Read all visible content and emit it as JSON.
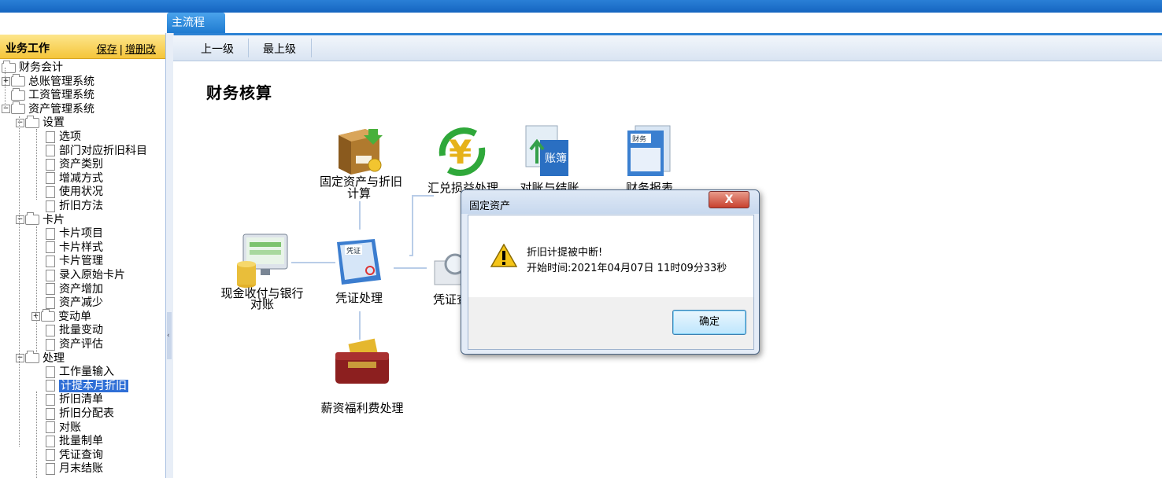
{
  "tabs": {
    "main": "主流程"
  },
  "sidebar": {
    "title": "业务工作",
    "save_link": "保存",
    "separator": "|",
    "edit_link": "增删改",
    "tree": [
      {
        "label": "财务会计",
        "level": 0,
        "kind": "folder"
      },
      {
        "label": "总账管理系统",
        "level": 1,
        "kind": "folder"
      },
      {
        "label": "工资管理系统",
        "level": 1,
        "kind": "folder"
      },
      {
        "label": "资产管理系统",
        "level": 1,
        "kind": "folder"
      },
      {
        "label": "设置",
        "level": 2,
        "kind": "folder"
      },
      {
        "label": "选项",
        "level": 3,
        "kind": "doc"
      },
      {
        "label": "部门对应折旧科目",
        "level": 3,
        "kind": "doc"
      },
      {
        "label": "资产类别",
        "level": 3,
        "kind": "doc"
      },
      {
        "label": "增减方式",
        "level": 3,
        "kind": "doc"
      },
      {
        "label": "使用状况",
        "level": 3,
        "kind": "doc"
      },
      {
        "label": "折旧方法",
        "level": 3,
        "kind": "doc"
      },
      {
        "label": "卡片",
        "level": 2,
        "kind": "folder"
      },
      {
        "label": "卡片项目",
        "level": 3,
        "kind": "doc"
      },
      {
        "label": "卡片样式",
        "level": 3,
        "kind": "doc"
      },
      {
        "label": "卡片管理",
        "level": 3,
        "kind": "doc"
      },
      {
        "label": "录入原始卡片",
        "level": 3,
        "kind": "doc"
      },
      {
        "label": "资产增加",
        "level": 3,
        "kind": "doc"
      },
      {
        "label": "资产减少",
        "level": 3,
        "kind": "doc"
      },
      {
        "label": "变动单",
        "level": 3,
        "kind": "folder"
      },
      {
        "label": "批量变动",
        "level": 3,
        "kind": "doc"
      },
      {
        "label": "资产评估",
        "level": 3,
        "kind": "doc"
      },
      {
        "label": "处理",
        "level": 2,
        "kind": "folder"
      },
      {
        "label": "工作量输入",
        "level": 3,
        "kind": "doc"
      },
      {
        "label": "计提本月折旧",
        "level": 3,
        "kind": "doc",
        "selected": true
      },
      {
        "label": "折旧清单",
        "level": 3,
        "kind": "doc"
      },
      {
        "label": "折旧分配表",
        "level": 3,
        "kind": "doc"
      },
      {
        "label": "对账",
        "level": 3,
        "kind": "doc"
      },
      {
        "label": "批量制单",
        "level": 3,
        "kind": "doc"
      },
      {
        "label": "凭证查询",
        "level": 3,
        "kind": "doc"
      },
      {
        "label": "月末结账",
        "level": 3,
        "kind": "doc"
      }
    ]
  },
  "toolbar": {
    "up_one": "上一级",
    "top_level": "最上级"
  },
  "main": {
    "heading": "财务核算",
    "nodes": {
      "fixed_assets": "固定资产与折旧计算",
      "fixed_assets_l1": "固定资产与折旧",
      "fixed_assets_l2": "计算",
      "fx": "汇兑损益处理",
      "reconcile": "对账与结账",
      "reports": "财务报表",
      "cash": "现金收付与银行对账",
      "cash_l1": "现金收付与银行",
      "cash_l2": "对账",
      "voucher": "凭证处理",
      "voucher_query": "凭证查询",
      "payroll": "薪资福利费处理"
    },
    "icon_texts": {
      "voucher_icon": "凭证",
      "ledger_icon": "账簿",
      "report_icon": "财务"
    }
  },
  "dialog": {
    "title": "固定资产",
    "close_label": "X",
    "message": "折旧计提被中断!",
    "start_time": "开始时间:2021年04月07日 11时09分33秒",
    "ok": "确定"
  },
  "colors": {
    "topbar": "#1565c0",
    "tab": "#2c82d4",
    "selection": "#2f6fd6",
    "sidebar_header": "#f5c53a"
  }
}
